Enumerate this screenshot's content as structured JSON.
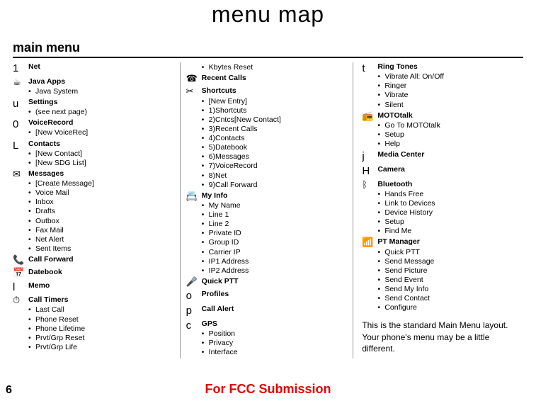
{
  "page": {
    "title": "menu map",
    "section": "main menu",
    "number": "6",
    "fcc": "For FCC Submission"
  },
  "note": "This is the standard Main Menu layout. Your phone's menu may be a little different.",
  "col1": [
    {
      "glyph": "1",
      "letter": true,
      "head": "Net",
      "items": []
    },
    {
      "glyph": "☕",
      "head": "Java Apps",
      "items": [
        "Java System"
      ]
    },
    {
      "glyph": "u",
      "letter": true,
      "head": "Settings",
      "items": [
        "(see next page)"
      ]
    },
    {
      "glyph": "0",
      "letter": true,
      "head": "VoiceRecord",
      "items": [
        "[New VoiceRec]"
      ]
    },
    {
      "glyph": "L",
      "letter": true,
      "head": "Contacts",
      "items": [
        "[New Contact]",
        "[New SDG List]"
      ]
    },
    {
      "glyph": "✉",
      "head": "Messages",
      "items": [
        "[Create Message]",
        "Voice Mail",
        "Inbox",
        "Drafts",
        "Outbox",
        "Fax Mail",
        "Net Alert",
        "Sent Items"
      ]
    },
    {
      "glyph": "📞",
      "head": "Call Forward",
      "items": []
    },
    {
      "glyph": "📅",
      "head": "Datebook",
      "items": []
    },
    {
      "glyph": "l",
      "letter": true,
      "head": "Memo",
      "items": []
    },
    {
      "glyph": "⏱",
      "head": "Call Timers",
      "items": [
        "Last Call",
        "Phone Reset",
        "Phone Lifetime",
        "Prvt/Grp Reset",
        "Prvt/Grp Life"
      ]
    }
  ],
  "col2": [
    {
      "glyph": "",
      "head": "",
      "items": [
        "Kbytes Reset"
      ]
    },
    {
      "glyph": "☎",
      "head": "Recent Calls",
      "items": []
    },
    {
      "glyph": "✂",
      "head": "Shortcuts",
      "items": [
        "[New Entry]",
        "1)Shortcuts",
        "2)Cntcs[New Contact]",
        "3)Recent Calls",
        "4)Contacts",
        "5)Datebook",
        "6)Messages",
        "7)VoiceRecord",
        "8)Net",
        "9)Call Forward"
      ]
    },
    {
      "glyph": "📇",
      "head": "My Info",
      "items": [
        "My Name",
        "Line 1",
        "Line 2",
        "Private ID",
        "Group ID",
        "Carrier IP",
        "IP1 Address",
        "IP2 Address"
      ]
    },
    {
      "glyph": "🎤",
      "head": "Quick PTT",
      "items": []
    },
    {
      "glyph": "o",
      "letter": true,
      "head": "Profiles",
      "items": []
    },
    {
      "glyph": "p",
      "letter": true,
      "head": "Call Alert",
      "items": []
    },
    {
      "glyph": "c",
      "letter": true,
      "head": "GPS",
      "items": [
        "Position",
        "Privacy",
        "Interface"
      ]
    }
  ],
  "col3": [
    {
      "glyph": "t",
      "letter": true,
      "head": "Ring Tones",
      "items": [
        "Vibrate All: On/Off",
        "Ringer",
        "Vibrate",
        "Silent"
      ]
    },
    {
      "glyph": "📻",
      "head": "MOTOtalk",
      "items": [
        "Go To MOTOtalk",
        "Setup",
        "Help"
      ]
    },
    {
      "glyph": "j",
      "letter": true,
      "head": "Media Center",
      "items": []
    },
    {
      "glyph": "H",
      "letter": true,
      "head": "Camera",
      "items": []
    },
    {
      "glyph": "ᛒ",
      "head": "Bluetooth",
      "items": [
        "Hands Free",
        "Link to Devices",
        "Device History",
        "Setup",
        "Find Me"
      ]
    },
    {
      "glyph": "📶",
      "head": "PT Manager",
      "items": [
        "Quick PTT",
        "Send Message",
        "Send Picture",
        "Send Event",
        "Send My Info",
        "Send Contact",
        "Configure"
      ]
    }
  ]
}
